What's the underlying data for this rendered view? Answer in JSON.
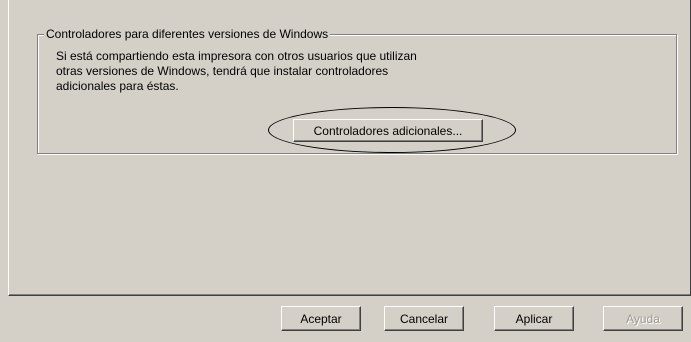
{
  "group": {
    "title": "Controladores para diferentes versiones de Windows",
    "description": "Si está compartiendo esta impresora con otros usuarios que utilizan\notras versiones de Windows, tendrá que instalar controladores\nadicionales para éstas.",
    "additional_drivers_button": "Controladores adicionales..."
  },
  "footer": {
    "ok_label": "Aceptar",
    "cancel_label": "Cancelar",
    "apply_label": "Aplicar",
    "help_label": "Ayuda"
  }
}
